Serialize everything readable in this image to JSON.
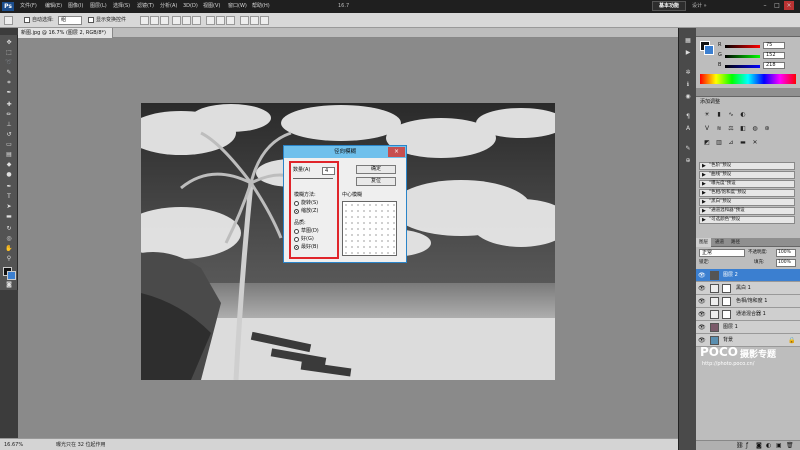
{
  "menubar": {
    "app_icon": "Ps",
    "items": [
      "文件(F)",
      "编辑(E)",
      "图像(I)",
      "图层(L)",
      "选择(S)",
      "滤镜(T)",
      "分析(A)",
      "3D(D)",
      "视图(V)",
      "窗口(W)",
      "帮助(H)"
    ],
    "zoom": "16.7",
    "workspace": "基本功能",
    "workspace_other": "设计 »"
  },
  "options": {
    "auto_select_label": "自动选择:",
    "auto_select_value": "组",
    "show_transform_label": "显示变换控件"
  },
  "document": {
    "tab": "新图.jpg @ 16.7% (图层 2, RGB/8*)",
    "close": "×"
  },
  "status": {
    "zoom": "16.67%",
    "info": "曝光只在 32 位起作用"
  },
  "color_panel": {
    "values": [
      "75",
      "152",
      "218"
    ],
    "channels": [
      "R",
      "G",
      "B"
    ]
  },
  "adjustments": {
    "title": "添加调整",
    "presets": [
      "\"色阶\"预设",
      "\"曲线\"预设",
      "\"曝光度\"预设",
      "\"色相/饱和度\"预设",
      "\"黑白\"预设",
      "\"通道混和器\"预设",
      "\"可选颜色\"预设"
    ]
  },
  "layers": {
    "tabs": [
      "图层",
      "通道",
      "路径"
    ],
    "blend_mode": "正常",
    "opacity_label": "不透明度:",
    "opacity": "100%",
    "fill_label": "填充:",
    "fill": "100%",
    "lock_label": "锁定:",
    "items": [
      "图层 2",
      "黑白 1",
      "色相/饱和度 1",
      "通道混合器 1",
      "图层 1",
      "背景"
    ]
  },
  "watermark": {
    "brand": "POCO",
    "slogan": "摄影专题",
    "url": "http://photo.poco.cn/"
  },
  "dialog": {
    "title": "径向模糊",
    "amount_label": "数量(A)",
    "amount": "4",
    "ok": "确定",
    "reset": "复位",
    "method_label": "模糊方法:",
    "methods": [
      "旋转(S)",
      "缩放(Z)"
    ],
    "quality_label": "品质:",
    "qualities": [
      "草图(D)",
      "好(G)",
      "最好(B)"
    ],
    "center_label": "中心模糊"
  },
  "colors": {
    "accent": "#3b7fd0",
    "highlight": "#e0242a",
    "dialog_title": "#6fc0ec"
  }
}
